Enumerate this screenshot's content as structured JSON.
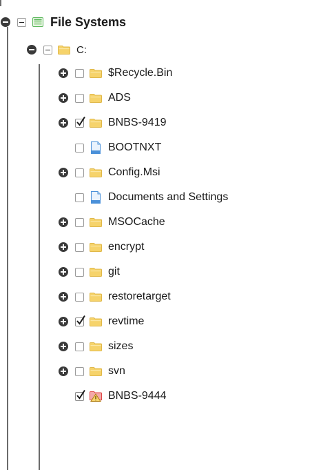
{
  "tree": {
    "root": {
      "label": "File Systems"
    },
    "drive": {
      "label": "C:"
    },
    "children": [
      {
        "name": "recycle-bin",
        "label": "$Recycle.Bin",
        "type": "folder",
        "expandable": true,
        "checked": false
      },
      {
        "name": "ads",
        "label": "ADS",
        "type": "folder",
        "expandable": true,
        "checked": false
      },
      {
        "name": "bnbs-9419",
        "label": "BNBS-9419",
        "type": "folder",
        "expandable": true,
        "checked": true
      },
      {
        "name": "bootnxt",
        "label": "BOOTNXT",
        "type": "file",
        "expandable": false,
        "checked": false
      },
      {
        "name": "config-msi",
        "label": "Config.Msi",
        "type": "folder",
        "expandable": true,
        "checked": false
      },
      {
        "name": "documents-and-settings",
        "label": "Documents and Settings",
        "type": "file",
        "expandable": false,
        "checked": false
      },
      {
        "name": "msocache",
        "label": "MSOCache",
        "type": "folder",
        "expandable": true,
        "checked": false
      },
      {
        "name": "encrypt",
        "label": "encrypt",
        "type": "folder",
        "expandable": true,
        "checked": false
      },
      {
        "name": "git",
        "label": "git",
        "type": "folder",
        "expandable": true,
        "checked": false
      },
      {
        "name": "restoretarget",
        "label": "restoretarget",
        "type": "folder",
        "expandable": true,
        "checked": false
      },
      {
        "name": "revtime",
        "label": "revtime",
        "type": "folder",
        "expandable": true,
        "checked": true
      },
      {
        "name": "sizes",
        "label": "sizes",
        "type": "folder",
        "expandable": true,
        "checked": false
      },
      {
        "name": "svn",
        "label": "svn",
        "type": "folder",
        "expandable": true,
        "checked": false
      },
      {
        "name": "bnbs-9444",
        "label": "BNBS-9444",
        "type": "folder-warning",
        "expandable": false,
        "checked": true
      }
    ]
  },
  "colors": {
    "folder": "#f6d36b",
    "file": "#4a90d9",
    "filesystem": "#5cb85c",
    "warning": "#e04848"
  }
}
